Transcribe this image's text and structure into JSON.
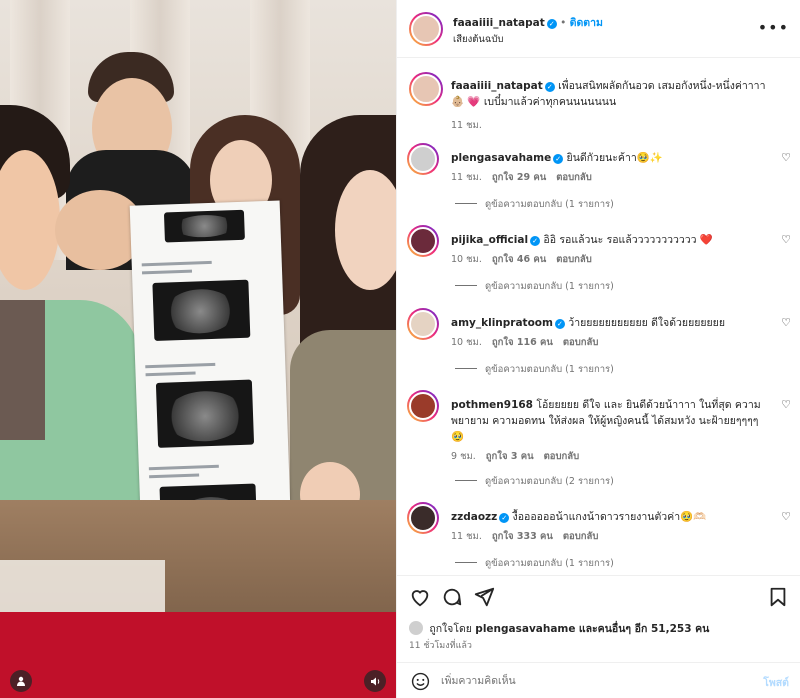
{
  "post": {
    "author": "faaaiiii_natapat",
    "follow_label": "ติดตาม",
    "audio": "เสียงต้นฉบับ",
    "caption": "เพื่อนสนิทผลัดกันอวด เสมอกังหนึ่ง-หนึ่งค่าาาา 👶🏼 💗 เบบี๋มาแล้วค่าทุกคนนนนนนน",
    "caption_time": "11 ชม."
  },
  "comments": [
    {
      "user": "plengasavahame",
      "text": "ยินดีกัวยนะค้าา🥹✨",
      "time": "11 ชม.",
      "likes": "ถูกใจ 29 คน",
      "reply": "ตอบกลับ",
      "view_replies": "ดูข้อความตอบกลับ (1 รายการ)"
    },
    {
      "user": "pijika_official",
      "text": "อิอิ รอแล้วนะ รอแล้ววววววววววว ❤️",
      "time": "10 ชม.",
      "likes": "ถูกใจ 46 คน",
      "reply": "ตอบกลับ",
      "view_replies": "ดูข้อความตอบกลับ (1 รายการ)"
    },
    {
      "user": "amy_klinpratoom",
      "text": "ว้ายยยยยยยยยยย ดีใจด้วยยยยยยย",
      "time": "10 ชม.",
      "likes": "ถูกใจ 116 คน",
      "reply": "ตอบกลับ",
      "view_replies": "ดูข้อความตอบกลับ (1 รายการ)"
    },
    {
      "user": "pothmen9168",
      "text": "โอ้ยยยยย ดีใจ และ ยินดีด้วยน้าาาา ในที่สุด ความพยายาม ความอดทน ให้ส่งผล ให้ผู้หญิงคนนี้ ได้สมหวัง นะฝ้ายยๆๆๆๆ 🥹",
      "time": "9 ชม.",
      "likes": "ถูกใจ 3 คน",
      "reply": "ตอบกลับ",
      "view_replies": "ดูข้อความตอบกลับ (2 รายการ)"
    },
    {
      "user": "zzdaozz",
      "text": "งื้ออออออน้าแกงน้าดาวรายงานตัวค่า🥹🫶🏻",
      "time": "11 ชม.",
      "likes": "ถูกใจ 333 คน",
      "reply": "ตอบกลับ",
      "view_replies": "ดูข้อความตอบกลับ (1 รายการ)"
    }
  ],
  "footer": {
    "liked_by_prefix": "ถูกใจโดย",
    "liked_by_user": "plengasavahame",
    "liked_by_suffix": "และคนอื่นๆ อีก 51,253 คน",
    "time_ago": "11 ชั่วโมงที่แล้ว",
    "comment_placeholder": "เพิ่มความคิดเห็น",
    "post_label": "โพสต์"
  },
  "icons": {
    "like": "heart-icon",
    "comment": "comment-icon",
    "share": "share-icon",
    "save": "bookmark-icon",
    "emoji": "emoji-icon",
    "more": "more-icon",
    "user_tag": "user-tag-icon",
    "sound": "sound-icon"
  },
  "colors": {
    "accent": "#0095f6",
    "muted": "#737373",
    "post_disabled": "#b3dbff"
  }
}
